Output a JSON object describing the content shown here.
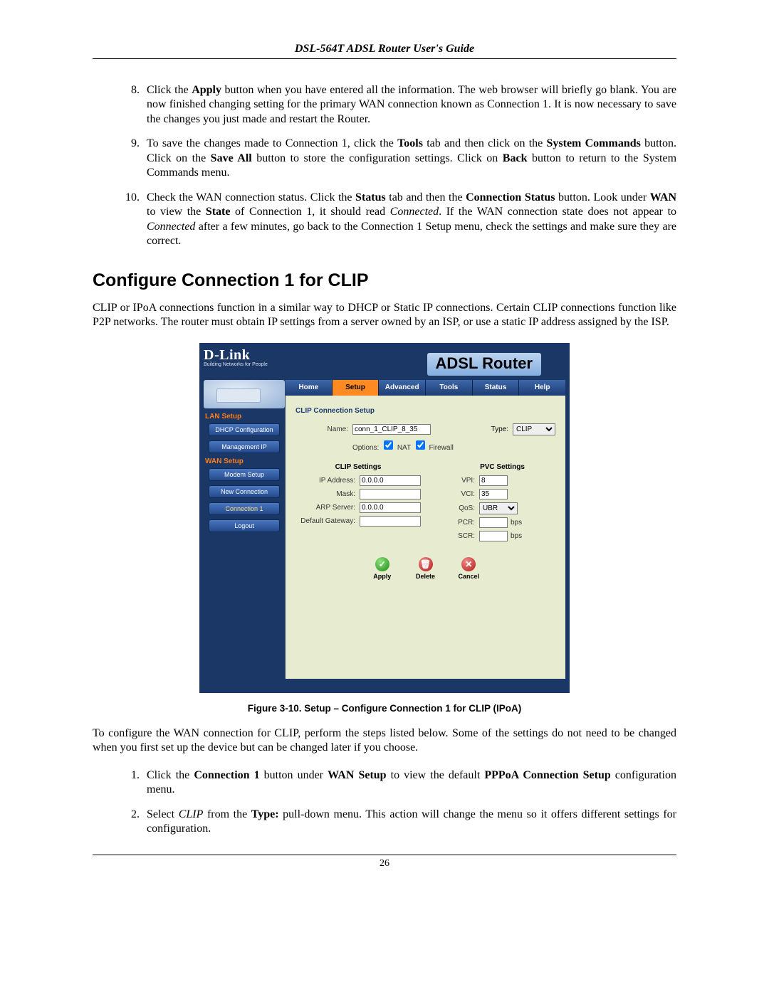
{
  "header": "DSL-564T ADSL Router User's Guide",
  "step8_a": "Click the ",
  "step8_b": "Apply",
  "step8_c": " button when you have entered all the information. The web browser will briefly go blank. You are now finished changing setting for the primary WAN connection known as Connection 1. It is now necessary to save the changes you just made and restart the Router.",
  "step9_a": "To save the changes made to Connection 1, click the ",
  "step9_b": "Tools",
  "step9_c": " tab and then click on the ",
  "step9_d": "System Commands",
  "step9_e": " button. Click on the ",
  "step9_f": "Save All",
  "step9_g": " button to store the configuration settings. Click on ",
  "step9_h": "Back",
  "step9_i": " button to return to the System Commands menu.",
  "step10_a": "Check the WAN connection status. Click the ",
  "step10_b": "Status",
  "step10_c": " tab and then the ",
  "step10_d": "Connection Status",
  "step10_e": " button. Look under ",
  "step10_f": "WAN",
  "step10_g": " to view the ",
  "step10_h": "State",
  "step10_i": " of Connection 1, it should read ",
  "step10_j": "Connected",
  "step10_k": ". If the WAN connection state does not appear to ",
  "step10_l": "Connected",
  "step10_m": " after a few minutes, go back to the Connection 1 Setup menu, check the settings and make sure they are correct.",
  "section_heading": "Configure Connection 1 for CLIP",
  "lead_para": "CLIP or IPoA connections function in a similar way to DHCP or Static IP connections. Certain CLIP connections function like P2P networks. The router must obtain IP settings from a server owned by an ISP, or use a static IP address assigned by the ISP.",
  "router": {
    "brand": "D-Link",
    "brand_sub": "Building Networks for People",
    "title": "ADSL Router",
    "tabs": {
      "home": "Home",
      "setup": "Setup",
      "advanced": "Advanced",
      "tools": "Tools",
      "status": "Status",
      "help": "Help"
    },
    "side": {
      "lan": "LAN Setup",
      "dhcp": "DHCP Configuration",
      "mgmt": "Management IP",
      "wan": "WAN Setup",
      "modem": "Modem Setup",
      "newc": "New Connection",
      "conn1": "Connection 1",
      "logout": "Logout"
    },
    "panel_title": "CLIP Connection Setup",
    "name_label": "Name:",
    "name_value": "conn_1_CLIP_8_35",
    "type_label": "Type:",
    "type_value": "CLIP",
    "options_label": "Options:",
    "opt_nat": "NAT",
    "opt_fw": "Firewall",
    "clip_heading": "CLIP Settings",
    "pvc_heading": "PVC Settings",
    "ip_label": "IP Address:",
    "ip_value": "0.0.0.0",
    "mask_label": "Mask:",
    "mask_value": "",
    "arp_label": "ARP Server:",
    "arp_value": "0.0.0.0",
    "gw_label": "Default Gateway:",
    "gw_value": "",
    "vpi_label": "VPI:",
    "vpi_value": "8",
    "vci_label": "VCI:",
    "vci_value": "35",
    "qos_label": "QoS:",
    "qos_value": "UBR",
    "pcr_label": "PCR:",
    "pcr_value": "",
    "scr_label": "SCR:",
    "scr_value": "",
    "bps": "bps",
    "apply": "Apply",
    "delete": "Delete",
    "cancel": "Cancel"
  },
  "fig_caption": "Figure 3-10. Setup – Configure Connection 1 for CLIP (IPoA)",
  "config_intro": "To configure the WAN connection for CLIP, perform the steps listed below. Some of the settings do not need to be changed when you first set up the device but can be changed later if you choose.",
  "cfg1_a": "Click the ",
  "cfg1_b": "Connection 1",
  "cfg1_c": " button under ",
  "cfg1_d": "WAN Setup",
  "cfg1_e": " to view the default ",
  "cfg1_f": "PPPoA Connection Setup",
  "cfg1_g": " configuration menu.",
  "cfg2_a": "Select ",
  "cfg2_b": "CLIP",
  "cfg2_c": " from the ",
  "cfg2_d": "Type:",
  "cfg2_e": " pull-down menu. This action will change the menu so it offers different settings for configuration.",
  "page_number": "26"
}
